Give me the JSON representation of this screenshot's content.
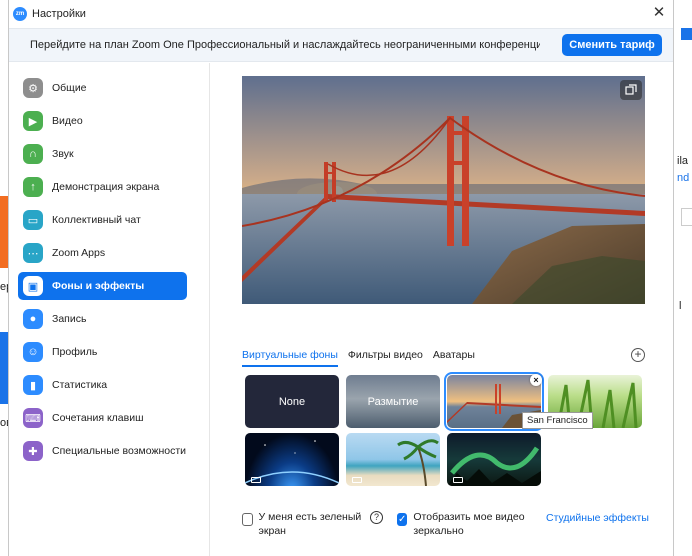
{
  "window": {
    "title": "Настройки",
    "logo_text": "zm",
    "close_glyph": "✕"
  },
  "banner": {
    "text": "Перейдите на план Zoom One Профессиональный и наслаждайтесь неограниченными конференциями,...",
    "button_label": "Сменить тариф"
  },
  "sidebar": {
    "items": [
      {
        "label": "Общие",
        "icon": "gear-icon",
        "color": "#8e8e8e"
      },
      {
        "label": "Видео",
        "icon": "video-camera-icon",
        "color": "#4caf50"
      },
      {
        "label": "Звук",
        "icon": "headphones-icon",
        "color": "#4caf50"
      },
      {
        "label": "Демонстрация экрана",
        "icon": "share-screen-icon",
        "color": "#4caf50"
      },
      {
        "label": "Коллективный чат",
        "icon": "chat-icon",
        "color": "#29a5c7"
      },
      {
        "label": "Zoom Apps",
        "icon": "apps-icon",
        "color": "#29a5c7"
      },
      {
        "label": "Фоны и эффекты",
        "icon": "background-icon",
        "color": "#0e72ed"
      },
      {
        "label": "Запись",
        "icon": "record-icon",
        "color": "#2d8cff"
      },
      {
        "label": "Профиль",
        "icon": "profile-icon",
        "color": "#2d8cff"
      },
      {
        "label": "Статистика",
        "icon": "statistics-icon",
        "color": "#2d8cff"
      },
      {
        "label": "Сочетания клавиш",
        "icon": "keyboard-icon",
        "color": "#8c63c9"
      },
      {
        "label": "Специальные возможности",
        "icon": "accessibility-icon",
        "color": "#8c63c9"
      }
    ],
    "active_index": 6
  },
  "tabs": [
    {
      "label": "Виртуальные фоны",
      "active": true
    },
    {
      "label": "Фильтры видео",
      "active": false
    },
    {
      "label": "Аватары",
      "active": false
    }
  ],
  "add_button_glyph": "+",
  "backgrounds": [
    {
      "label": "None",
      "kind": "none"
    },
    {
      "label": "Размытие",
      "kind": "blur"
    },
    {
      "label": "",
      "kind": "bridge",
      "selected": true
    },
    {
      "label": "",
      "kind": "grass"
    },
    {
      "label": "",
      "kind": "earth"
    },
    {
      "label": "",
      "kind": "beach"
    },
    {
      "label": "",
      "kind": "aurora"
    }
  ],
  "tooltip": "San Francisco",
  "options": {
    "green_screen_label": "У меня есть зеленый экран",
    "green_screen_checked": false,
    "mirror_label": "Отобразить мое видео зеркально",
    "mirror_checked": true,
    "studio_effects_link": "Студийные эффекты"
  },
  "background_fragments": {
    "left_top": "ер",
    "left_bottom": "ов",
    "right_1": "ila",
    "right_2": "nd",
    "right_3": "l"
  }
}
